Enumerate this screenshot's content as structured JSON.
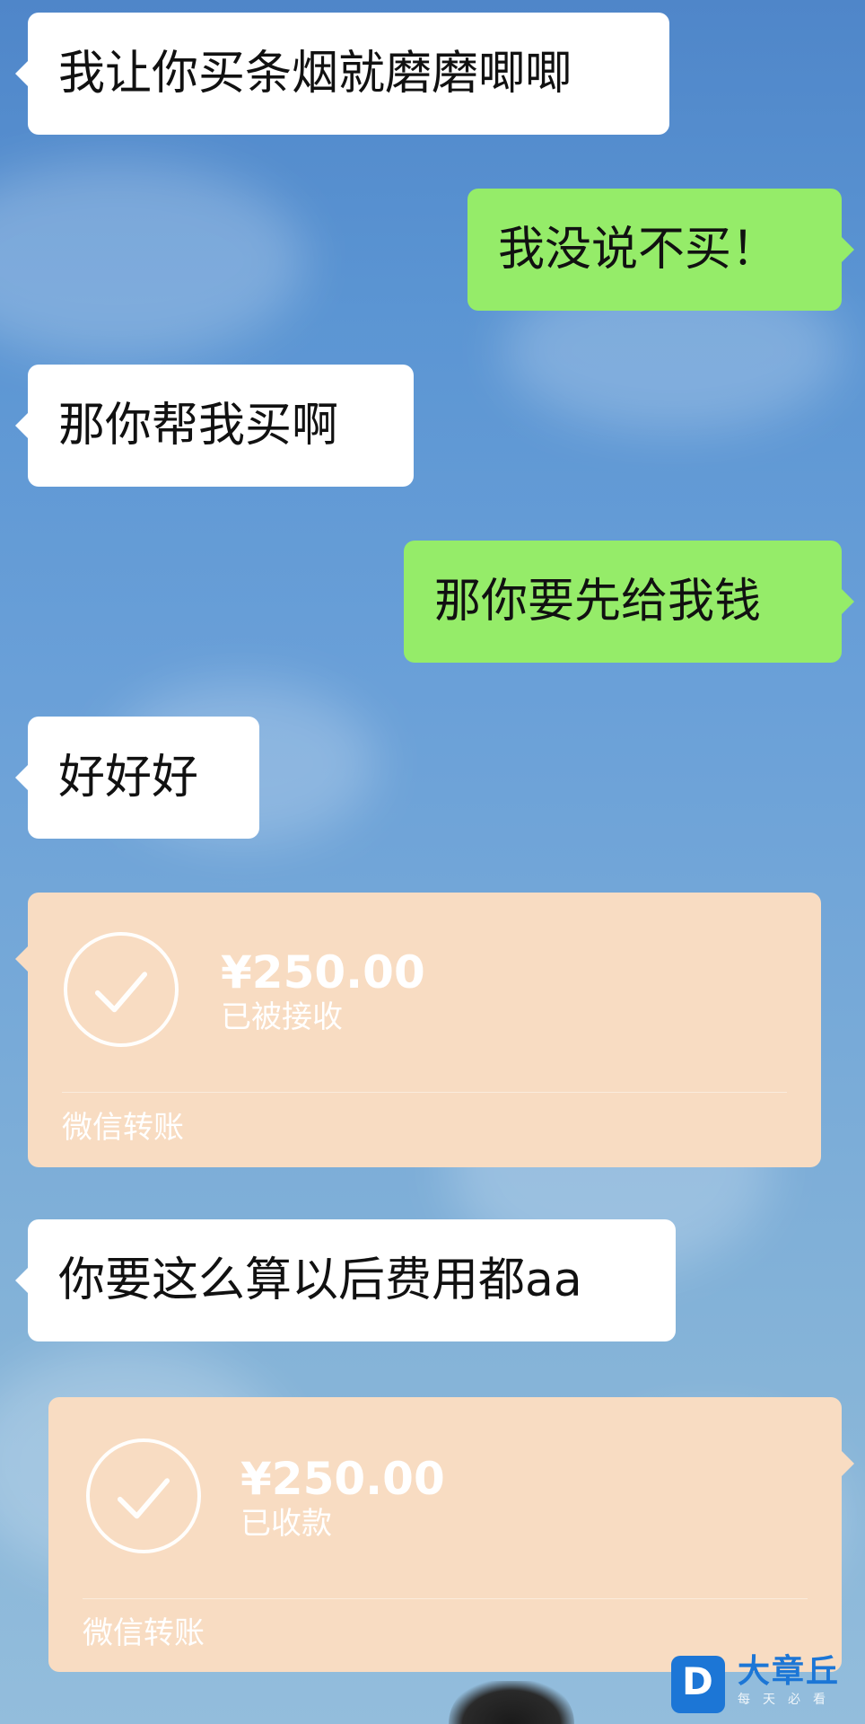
{
  "messages": [
    {
      "side": "left",
      "type": "text",
      "text": "我让你买条烟就磨磨唧唧"
    },
    {
      "side": "right",
      "type": "text",
      "text": "我没说不买！"
    },
    {
      "side": "left",
      "type": "text",
      "text": "那你帮我买啊"
    },
    {
      "side": "right",
      "type": "text",
      "text": "那你要先给我钱"
    },
    {
      "side": "left",
      "type": "text",
      "text": "好好好"
    },
    {
      "side": "left",
      "type": "transfer",
      "amount": "¥250.00",
      "status": "已被接收",
      "service": "微信转账"
    },
    {
      "side": "left",
      "type": "text",
      "text": "你要这么算以后费用都aa"
    },
    {
      "side": "right",
      "type": "transfer",
      "amount": "¥250.00",
      "status": "已收款",
      "service": "微信转账"
    }
  ],
  "colors": {
    "white_bubble": "#ffffff",
    "green_bubble": "#95ec69",
    "transfer_card": "#f8dcc2",
    "watermark_blue": "#1c76d6"
  },
  "watermark": {
    "brand": "大章丘",
    "slogan": "每天必看",
    "logo": "D"
  }
}
